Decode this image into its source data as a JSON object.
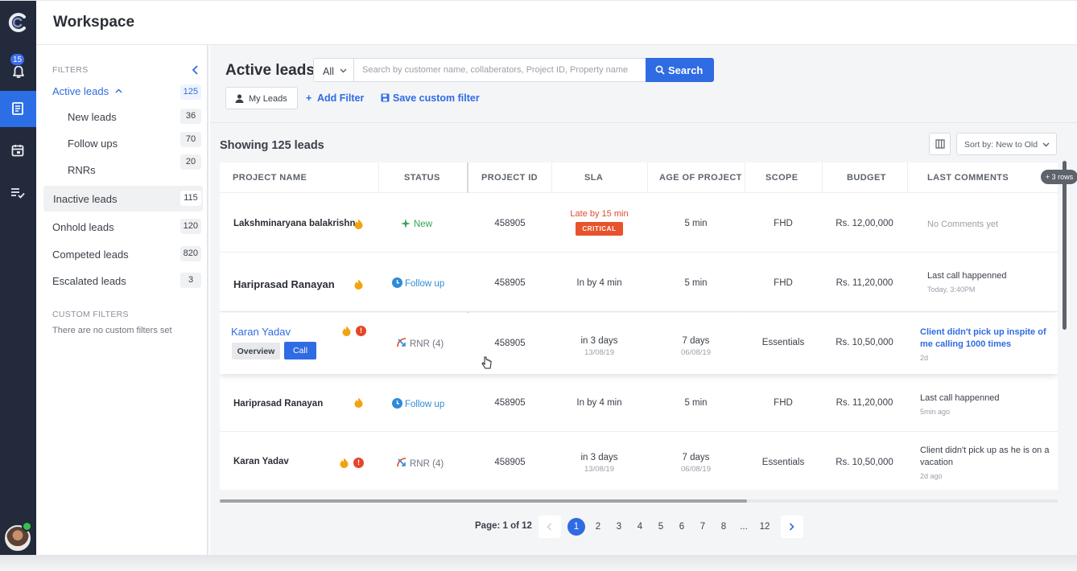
{
  "app": {
    "title": "Workspace",
    "notification_count": "15"
  },
  "sidebar": {
    "filters_label": "FILTERS",
    "items": [
      {
        "label": "Active leads",
        "count": "125"
      },
      {
        "label": "New leads",
        "count": "36"
      },
      {
        "label": "Follow ups",
        "count": "70"
      },
      {
        "label": "RNRs",
        "count": "20"
      },
      {
        "label": "Inactive leads",
        "count": "115"
      },
      {
        "label": "Onhold leads",
        "count": "120"
      },
      {
        "label": "Competed leads",
        "count": "820"
      },
      {
        "label": "Escalated leads",
        "count": "3"
      }
    ],
    "custom_filters_label": "CUSTOM FILTERS",
    "custom_filters_empty": "There are no custom filters set"
  },
  "toolbar": {
    "title": "Active leads",
    "scope": "All",
    "search_placeholder": "Search by customer name, collaberators, Project ID, Property name",
    "search_label": "Search",
    "my_leads": "My Leads",
    "add_filter": "Add Filter",
    "save_filter": "Save custom filter"
  },
  "results": {
    "showing": "Showing 125 leads",
    "sort": "Sort by: New to Old",
    "more_rows": "+ 3 rows"
  },
  "table": {
    "headers": [
      "PROJECT NAME",
      "STATUS",
      "PROJECT ID",
      "SLA",
      "AGE OF PROJECT",
      "SCOPE",
      "BUDGET",
      "LAST COMMENTS"
    ],
    "rows": [
      {
        "name": "Lakshminaryana balakrishn",
        "status": "New",
        "project_id": "458905",
        "sla": "Late by 15 min",
        "sla_badge": "CRITICAL",
        "age": "5 min",
        "scope": "FHD",
        "budget": "Rs. 12,00,000",
        "comment": "No Comments yet"
      },
      {
        "name": "Hariprasad Ranayan",
        "status": "Follow up",
        "project_id": "458905",
        "sla": "In by 4 min",
        "age": "5 min",
        "scope": "FHD",
        "budget": "Rs. 11,20,000",
        "comment": "Last call happenned",
        "comment_time": "Today, 3:40PM"
      },
      {
        "name": "Karan Yadav",
        "status": "RNR (4)",
        "project_id": "458905",
        "sla": "in 3 days",
        "sla_date": "13/08/19",
        "age": "7 days",
        "age_date": "06/08/19",
        "scope": "Essentials",
        "budget": "Rs. 10,50,000",
        "comment": "Client didn't pick up inspite of me calling 1000 times",
        "comment_time": "2d",
        "overview": "Overview",
        "call": "Call"
      },
      {
        "name": "Hariprasad Ranayan",
        "status": "Follow up",
        "project_id": "458905",
        "sla": "In by 4 min",
        "age": "5 min",
        "scope": "FHD",
        "budget": "Rs. 11,20,000",
        "comment": "Last call happenned",
        "comment_time": "5min ago"
      },
      {
        "name": "Karan Yadav",
        "status": "RNR (4)",
        "project_id": "458905",
        "sla": "in 3 days",
        "sla_date": "13/08/19",
        "age": "7 days",
        "age_date": "06/08/19",
        "scope": "Essentials",
        "budget": "Rs. 10,50,000",
        "comment": "Client didn't pick up as he is on a vacation",
        "comment_time": "2d ago"
      }
    ]
  },
  "pagination": {
    "label": "Page: 1 of 12",
    "pages": [
      "1",
      "2",
      "3",
      "4",
      "5",
      "6",
      "7",
      "8",
      "...",
      "12"
    ]
  },
  "colors": {
    "accent": "#2f6be2",
    "rail": "#232a3b",
    "critical": "#e8522c",
    "new": "#2ea84f",
    "follow_up": "#2f8bd6"
  },
  "icons": {
    "logo": "logo-icon",
    "notifications": "bell-icon",
    "leads": "book-icon",
    "calendar": "calendar-icon",
    "tasks": "checklist-icon",
    "hot": "flame-icon",
    "alert": "alert-icon"
  }
}
